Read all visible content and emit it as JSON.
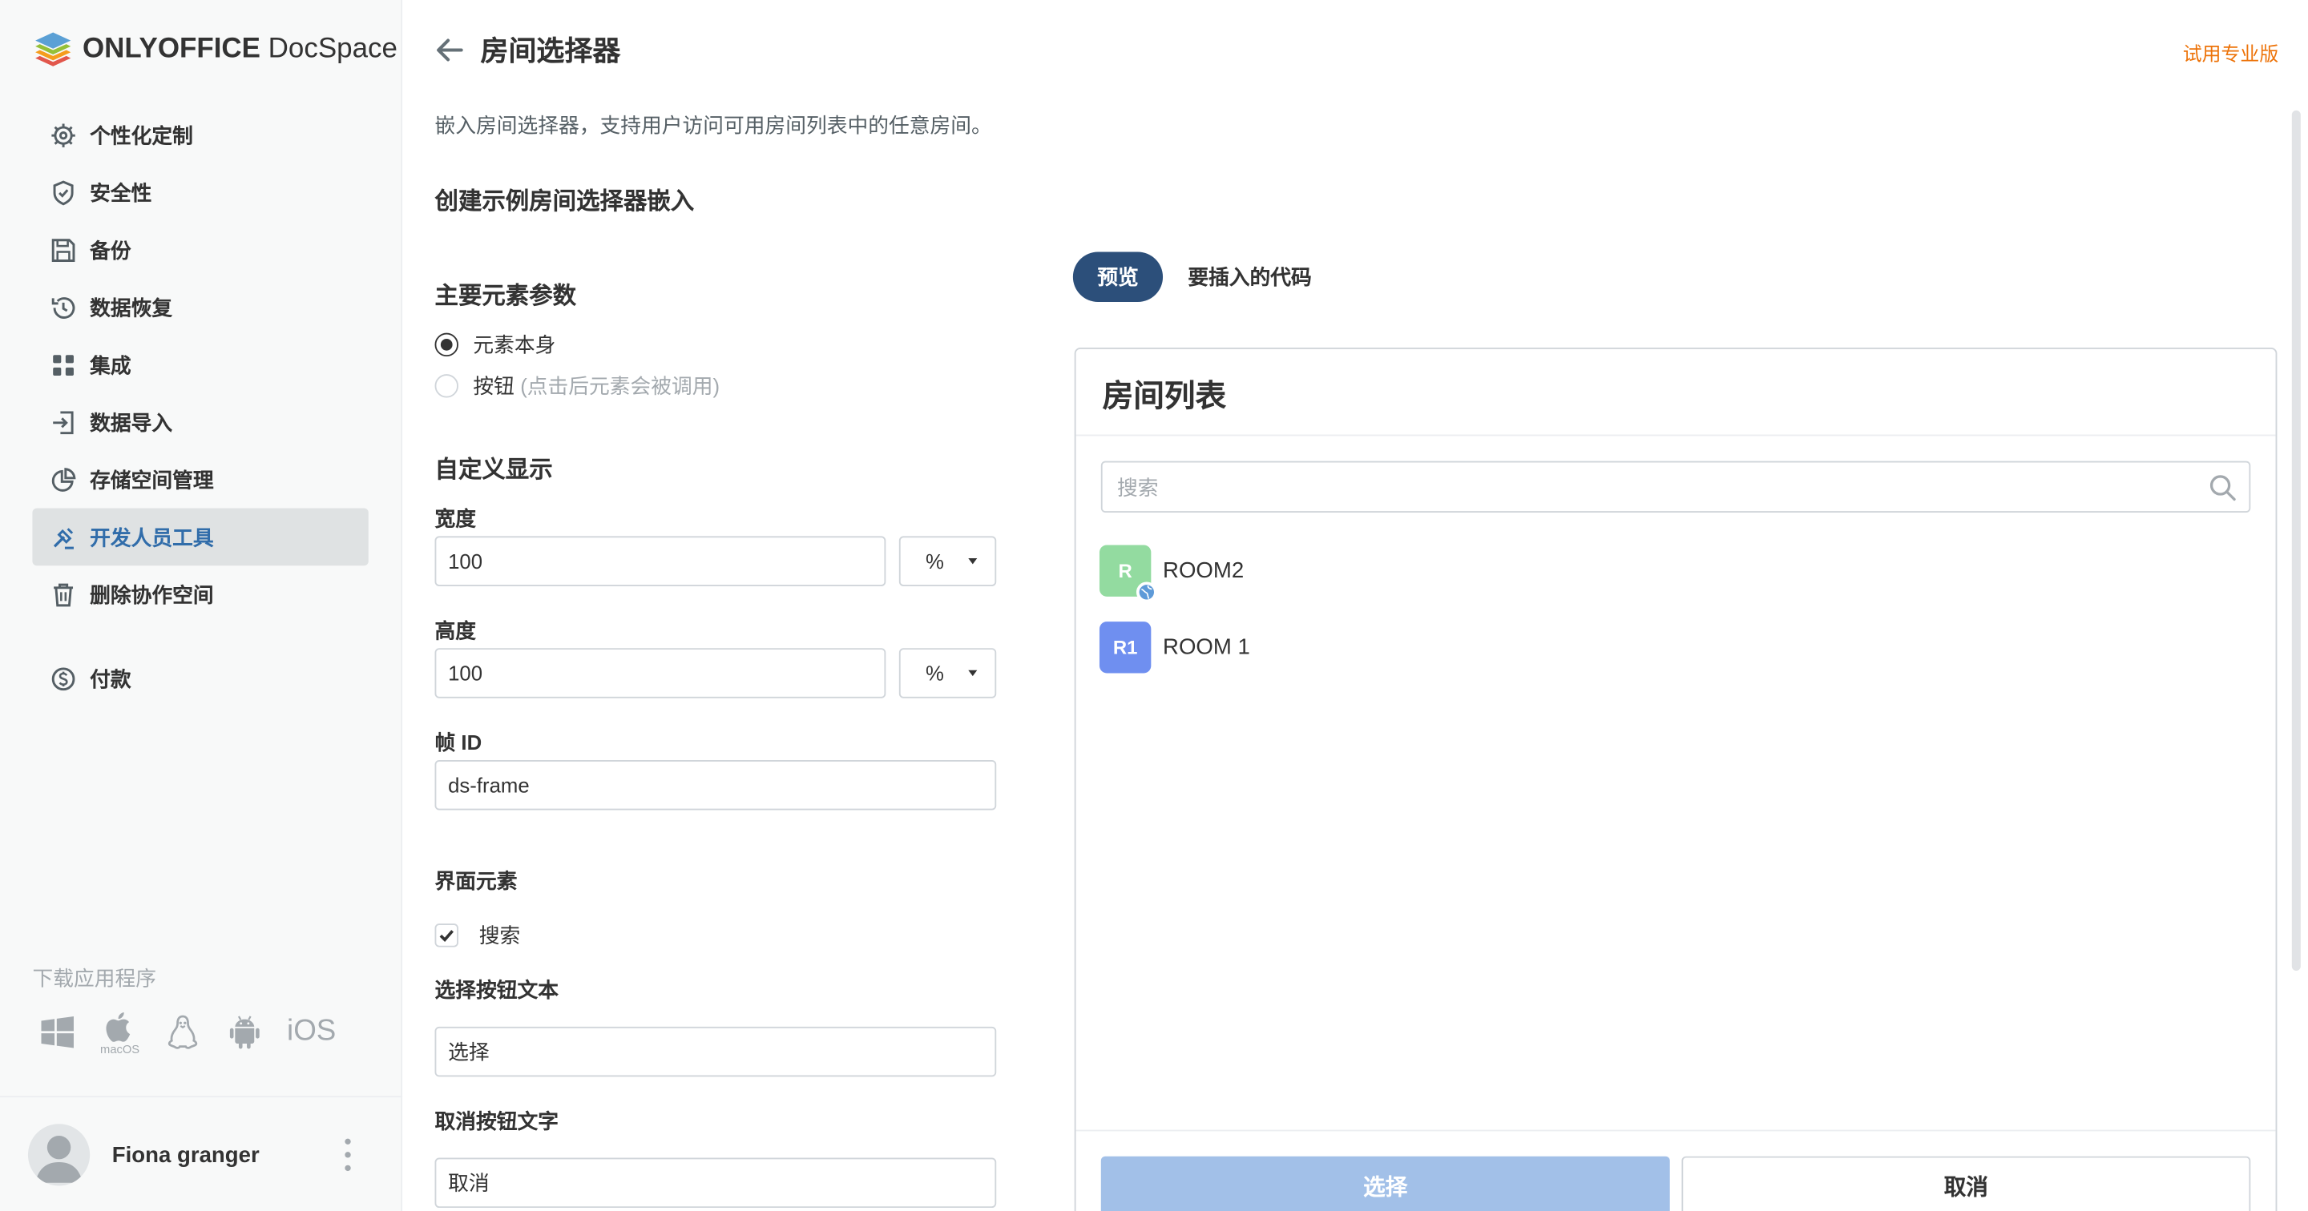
{
  "brand": {
    "name_bold": "ONLYOFFICE",
    "name_light": " DocSpace"
  },
  "sidebar": {
    "items": [
      {
        "label": "个性化定制",
        "icon": "gear-icon"
      },
      {
        "label": "安全性",
        "icon": "shield-icon"
      },
      {
        "label": "备份",
        "icon": "save-icon"
      },
      {
        "label": "数据恢复",
        "icon": "history-icon"
      },
      {
        "label": "集成",
        "icon": "grid-icon"
      },
      {
        "label": "数据导入",
        "icon": "import-icon"
      },
      {
        "label": "存储空间管理",
        "icon": "pie-chart-icon"
      },
      {
        "label": "开发人员工具",
        "icon": "developer-tools-icon",
        "active": true
      },
      {
        "label": "删除协作空间",
        "icon": "trash-icon"
      },
      {
        "label": "付款",
        "icon": "dollar-icon"
      }
    ],
    "download_title": "下载应用程序",
    "apps": {
      "macos": "macOS",
      "ios": "iOS"
    },
    "user_name": "Fiona granger"
  },
  "header": {
    "title": "房间选择器",
    "trial": "试用专业版"
  },
  "main": {
    "description": "嵌入房间选择器，支持用户访问可用房间列表中的任意房间。",
    "create_heading": "创建示例房间选择器嵌入",
    "main_params_heading": "主要元素参数",
    "radio_element": "元素本身",
    "radio_button": "按钮",
    "radio_button_hint": "(点击后元素会被调用)",
    "custom_display_heading": "自定义显示",
    "width_label": "宽度",
    "width_value": "100",
    "width_unit": "%",
    "height_label": "高度",
    "height_value": "100",
    "height_unit": "%",
    "frame_id_label": "帧 ID",
    "frame_id_value": "ds-frame",
    "ui_elements_heading": "界面元素",
    "search_checkbox": "搜索",
    "search_checked": true,
    "select_text_label": "选择按钮文本",
    "select_text_value": "选择",
    "cancel_text_label": "取消按钮文字",
    "cancel_text_value": "取消"
  },
  "tabs": {
    "preview": "预览",
    "code": "要插入的代码"
  },
  "preview": {
    "title": "房间列表",
    "search_placeholder": "搜索",
    "rooms": [
      {
        "logo": "R",
        "name": "ROOM2",
        "color": "#93dba0",
        "public": true
      },
      {
        "logo": "R1",
        "name": "ROOM 1",
        "color": "#6f8ff0",
        "public": false
      }
    ],
    "select_button": "选择",
    "cancel_button": "取消"
  },
  "colors": {
    "accent": "#316daa",
    "active_tab": "#2c4f7a",
    "trial": "#ed7309",
    "select_button": "#a2c0e8"
  }
}
